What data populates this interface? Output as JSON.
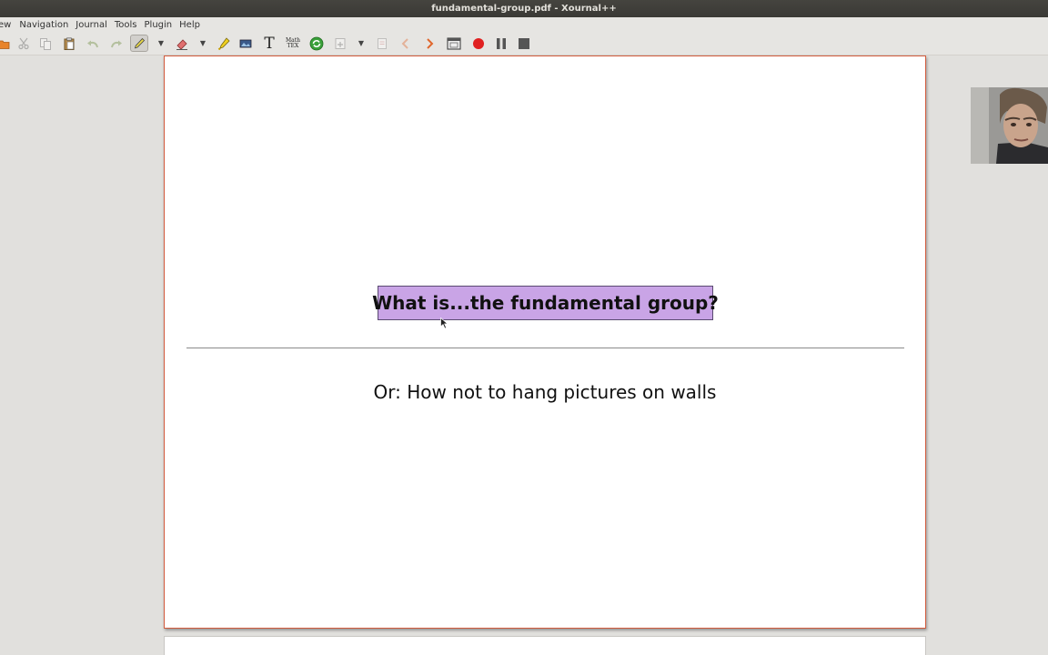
{
  "window": {
    "title": "fundamental-group.pdf - Xournal++"
  },
  "menubar": {
    "items": [
      "ew",
      "Navigation",
      "Journal",
      "Tools",
      "Plugin",
      "Help"
    ]
  },
  "toolbar": {
    "tools": [
      {
        "name": "folder-icon",
        "label": "Open"
      },
      {
        "name": "cut-icon",
        "label": "Cut"
      },
      {
        "name": "copy-icon",
        "label": "Copy"
      },
      {
        "name": "paste-icon",
        "label": "Paste"
      },
      {
        "name": "undo-icon",
        "label": "Undo"
      },
      {
        "name": "redo-icon",
        "label": "Redo"
      },
      {
        "name": "pen-icon",
        "label": "Pen",
        "active": true
      },
      {
        "name": "eraser-icon",
        "label": "Eraser"
      },
      {
        "name": "highlighter-icon",
        "label": "Highlighter"
      },
      {
        "name": "image-icon",
        "label": "Image"
      },
      {
        "name": "text-icon",
        "label": "Text",
        "glyph": "T"
      },
      {
        "name": "math-tex-icon",
        "label": "Math TeX",
        "glyph": "Math TEX"
      },
      {
        "name": "refresh-icon",
        "label": "Refresh"
      },
      {
        "name": "insert-page-icon",
        "label": "Insert page"
      },
      {
        "name": "page-icon",
        "label": "Page"
      },
      {
        "name": "previous-page-icon",
        "label": "Previous page"
      },
      {
        "name": "next-page-icon",
        "label": "Next page"
      },
      {
        "name": "fullscreen-icon",
        "label": "Fullscreen"
      },
      {
        "name": "record-icon",
        "label": "Record"
      },
      {
        "name": "pause-icon",
        "label": "Pause"
      },
      {
        "name": "stop-icon",
        "label": "Stop"
      }
    ]
  },
  "colors": {
    "title_box_fill": "#c9a4e6",
    "page_border": "#d25b3d",
    "record_red": "#e02020"
  },
  "slide": {
    "title": "What is...the fundamental group?",
    "subtitle": "Or: How not to hang pictures on walls"
  }
}
